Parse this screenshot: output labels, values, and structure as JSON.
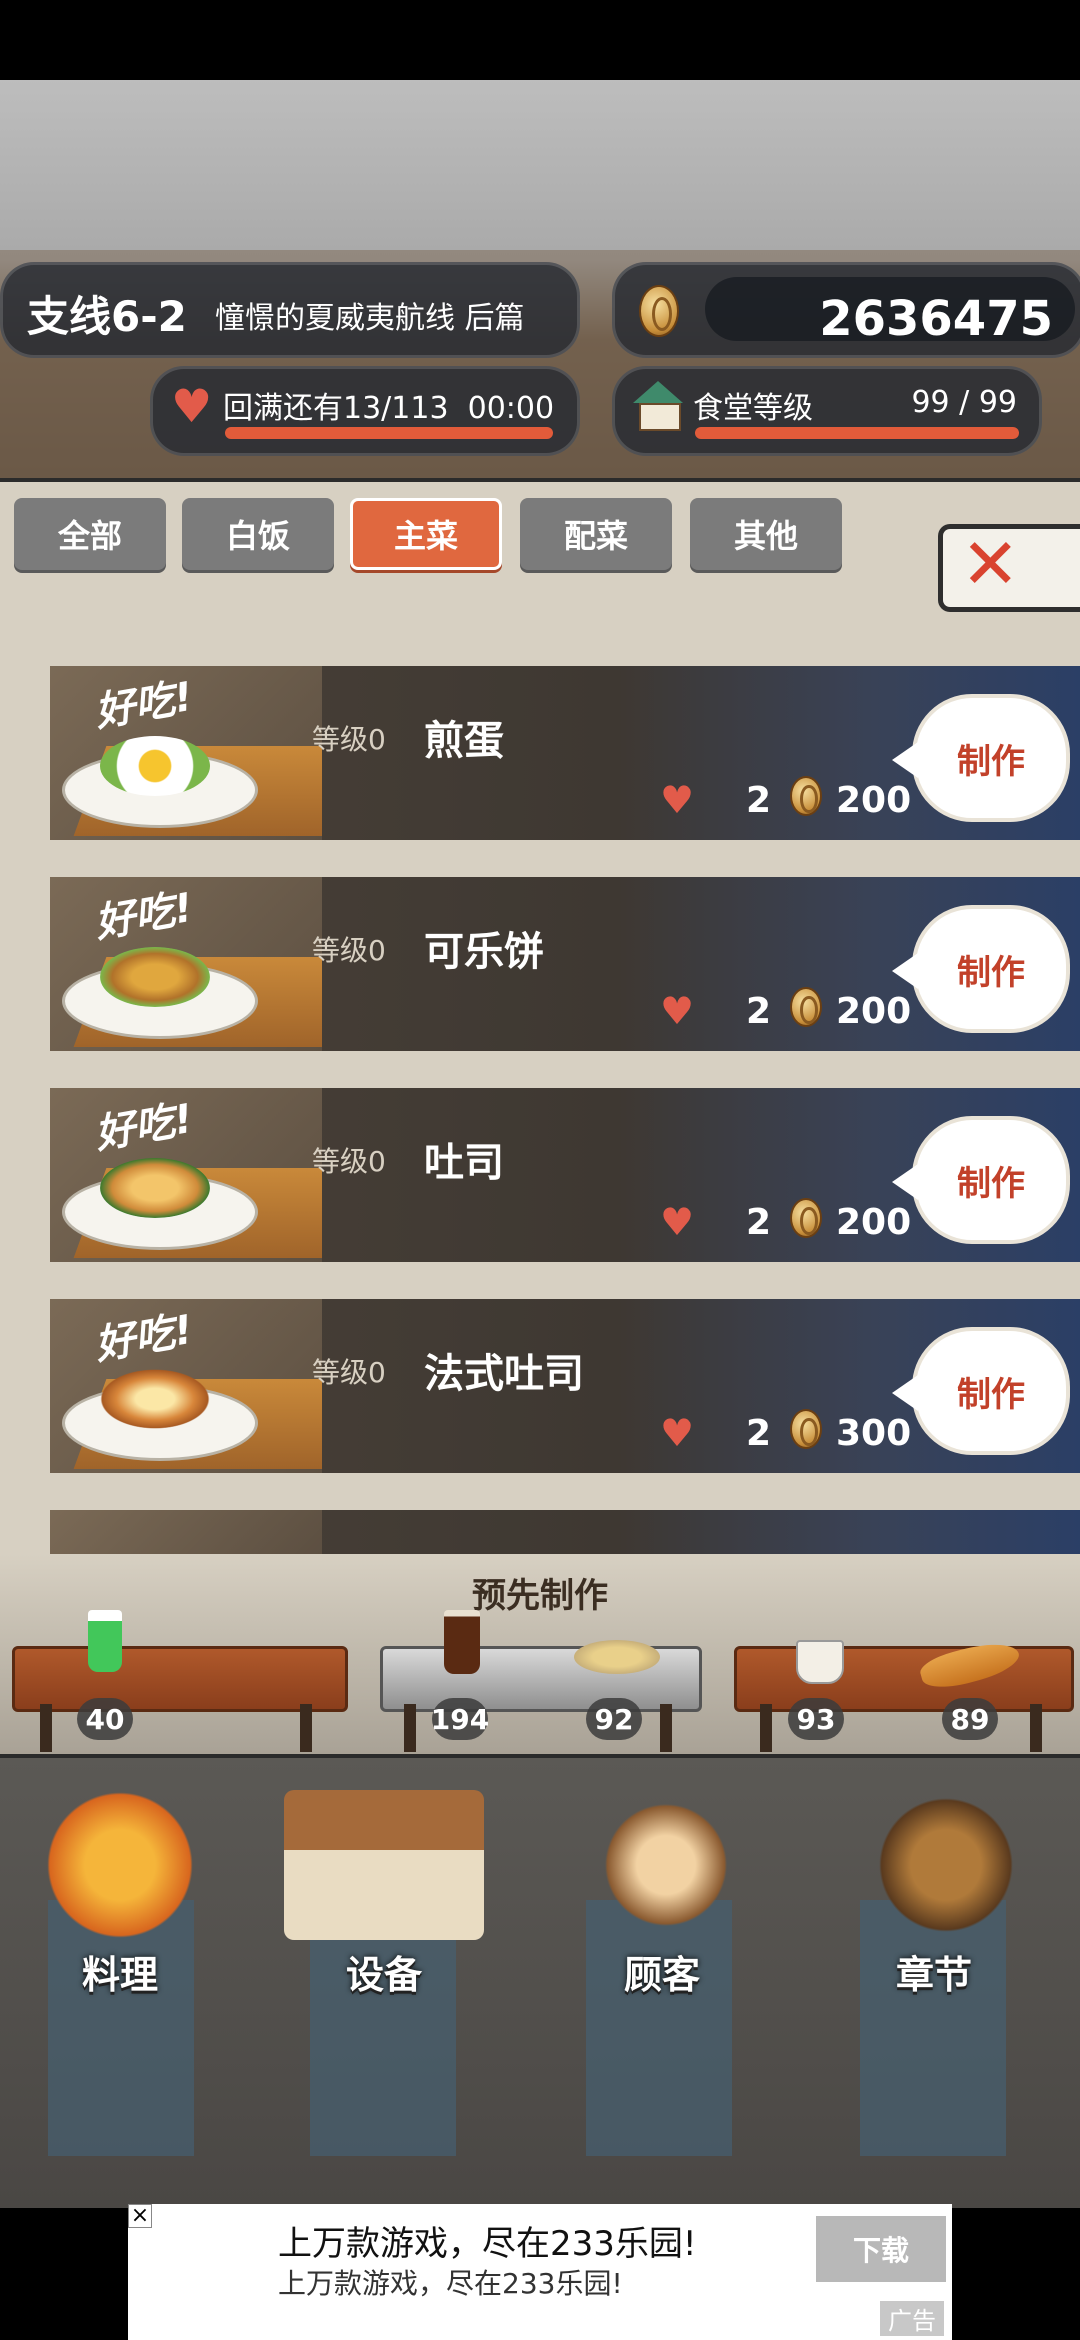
{
  "header": {
    "stage_code": "支线6-2",
    "stage_title": "憧憬的夏威夷航线 后篇",
    "coins": "2636475",
    "hp_label": "回满还有13/113",
    "hp_timer": "00:00",
    "level_label": "食堂等级",
    "level_value": "99 / 99"
  },
  "tabs": [
    {
      "label": "全部"
    },
    {
      "label": "白饭"
    },
    {
      "label": "主菜",
      "active": true
    },
    {
      "label": "配菜"
    },
    {
      "label": "其他"
    }
  ],
  "close_icon": "close-x-icon",
  "recipes": [
    {
      "yum": "好吃!",
      "level": "等级0",
      "name": "煎蛋",
      "love": "2",
      "price": "200",
      "make": "制作",
      "food_color": "#f1c33b"
    },
    {
      "yum": "好吃!",
      "level": "等级0",
      "name": "可乐饼",
      "love": "2",
      "price": "200",
      "make": "制作",
      "food_color": "#c98a2e"
    },
    {
      "yum": "好吃!",
      "level": "等级0",
      "name": "吐司",
      "love": "2",
      "price": "200",
      "make": "制作",
      "food_color": "#e4a650"
    },
    {
      "yum": "好吃!",
      "level": "等级0",
      "name": "法式吐司",
      "love": "2",
      "price": "300",
      "make": "制作",
      "food_color": "#d8863a"
    }
  ],
  "prepared": {
    "title": "预先制作",
    "items": [
      {
        "count": "40",
        "icon": "melon-soda-icon"
      },
      {
        "count": "194",
        "icon": "cola-glass-icon"
      },
      {
        "count": "92",
        "icon": "rice-dish-icon"
      },
      {
        "count": "93",
        "icon": "soup-cup-icon"
      },
      {
        "count": "89",
        "icon": "fish-plate-icon"
      }
    ]
  },
  "nav": [
    {
      "label": "料理",
      "icon": "cooking-pot-icon"
    },
    {
      "label": "设备",
      "icon": "house-icon"
    },
    {
      "label": "顾客",
      "icon": "customers-icon"
    },
    {
      "label": "章节",
      "icon": "film-camera-icon"
    }
  ],
  "ad": {
    "line1": "上万款游戏，尽在233乐园!",
    "line2": "上万款游戏，尽在233乐园!",
    "download": "下载",
    "tag": "广告"
  },
  "colors": {
    "accent": "#e0683f",
    "heart": "#e25b4a",
    "make_text": "#c2412a"
  }
}
